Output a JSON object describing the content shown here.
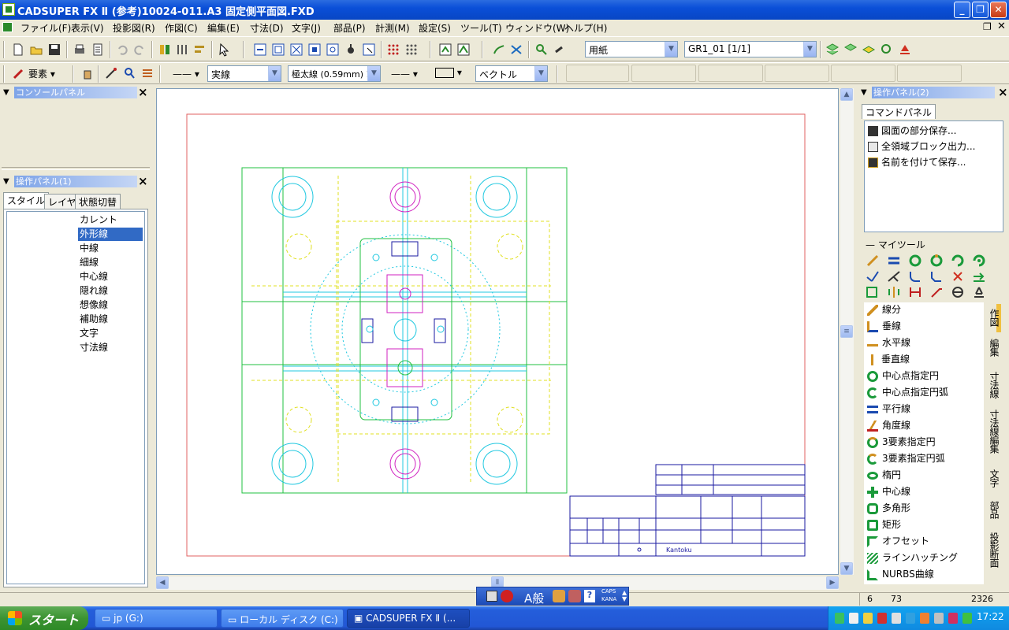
{
  "window": {
    "title": "CADSUPER FX Ⅱ (参考)10024-011.A3 固定側平面図.FXD",
    "buttons": [
      "minimize",
      "maximize",
      "close"
    ]
  },
  "menu": [
    "ファイル(F)",
    "表示(V)",
    "投影図(R)",
    "作図(C)",
    "編集(E)",
    "寸法(D)",
    "文字(J)",
    "部品(P)",
    "計測(M)",
    "設定(S)",
    "ツール(T)",
    "ウィンドウ(W)",
    "ヘルプ(H)"
  ],
  "toolbar1": {
    "paper_combo": "用紙",
    "layer_combo": "GR1_01 [1/1]"
  },
  "toolbar2": {
    "element_button": "要素",
    "linetype_combo": "実線",
    "linewidth_combo": "極太線 (0.59mm) 1",
    "vector_combo": "ベクトル"
  },
  "console_panel": {
    "title": "コンソールパネル"
  },
  "op_panel1": {
    "title": "操作パネル(1)",
    "tabs": [
      "スタイル",
      "レイヤ",
      "状態切替"
    ],
    "active_tab": "スタイル",
    "styles": [
      "カレント",
      "外形線",
      "中線",
      "細線",
      "中心線",
      "隠れ線",
      "想像線",
      "補助線",
      "文字",
      "寸法線"
    ],
    "selected_style": "外形線"
  },
  "op_panel2": {
    "title": "操作パネル(2)",
    "tab": "コマンドパネル",
    "commands": [
      "図面の部分保存...",
      "全領域ブロック出力...",
      "名前を付けて保存..."
    ],
    "mytool_label": "マイツール",
    "tools": [
      "線分",
      "垂線",
      "水平線",
      "垂直線",
      "中心点指定円",
      "中心点指定円弧",
      "平行線",
      "角度線",
      "3要素指定円",
      "3要素指定円弧",
      "楕円",
      "中心線",
      "多角形",
      "矩形",
      "オフセット",
      "ラインハッチング",
      "NURBS曲線"
    ],
    "side_tabs": [
      "作図",
      "編集",
      "寸法線",
      "寸法線編集",
      "文字",
      "部品",
      "投影断面"
    ]
  },
  "drawing": {
    "title_block_text": "Kantoku"
  },
  "statusbar": {
    "x": "6",
    "y": "73",
    "value": "2326"
  },
  "ime": {
    "mode": "A般",
    "caps": "CAPS",
    "kana": "KANA"
  },
  "taskbar": {
    "start": "スタート",
    "tasks": [
      "jp (G:)",
      "ローカル ディスク (C:)",
      "CADSUPER FX Ⅱ (..."
    ],
    "clock": "17:22"
  }
}
